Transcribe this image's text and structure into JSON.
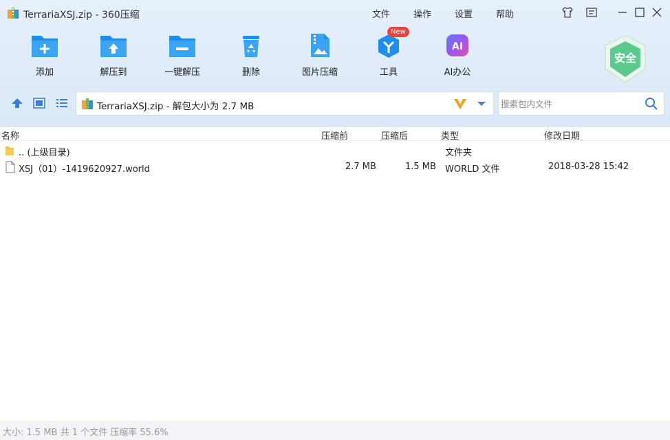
{
  "window": {
    "title": "TerrariaXSJ.zip - 360压缩",
    "menu": [
      "文件",
      "操作",
      "设置",
      "帮助"
    ]
  },
  "toolbar": {
    "items": [
      {
        "label": "添加",
        "icon": "add-folder-icon"
      },
      {
        "label": "解压到",
        "icon": "extract-to-icon"
      },
      {
        "label": "一键解压",
        "icon": "one-click-extract-icon"
      },
      {
        "label": "删除",
        "icon": "delete-icon"
      },
      {
        "label": "图片压缩",
        "icon": "image-compress-icon"
      },
      {
        "label": "工具",
        "icon": "tools-icon",
        "badge": "New"
      },
      {
        "label": "AI办公",
        "icon": "ai-office-icon",
        "icon_text": "AI"
      }
    ],
    "safe_badge": "安全"
  },
  "address": {
    "path": "TerrariaXSJ.zip - 解包大小为 2.7 MB",
    "search_placeholder": "搜索包内文件"
  },
  "columns": {
    "name": "名称",
    "packed": "压缩前",
    "compressed": "压缩后",
    "type": "类型",
    "modified": "修改日期"
  },
  "files": [
    {
      "name": ".. (上级目录)",
      "packed": "",
      "compressed": "",
      "type": "文件夹",
      "modified": "",
      "icon": "folder-icon"
    },
    {
      "name": "XSJ（01）-1419620927.world",
      "packed": "2.7 MB",
      "compressed": "1.5 MB",
      "type": "WORLD 文件",
      "modified": "2018-03-28 15:42",
      "icon": "file-icon"
    }
  ],
  "status": "大小: 1.5 MB 共 1 个文件 压缩率 55.6%",
  "colors": {
    "accent": "#1e8ee8",
    "header_bg": "#e3eefa",
    "safe_green": "#4cc48a"
  }
}
